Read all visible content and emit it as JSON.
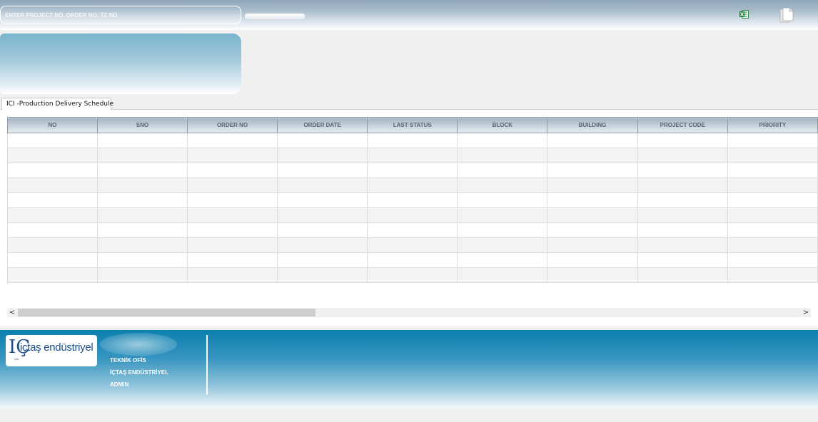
{
  "topbar": {
    "search_placeholder": "ENTER PROJECT NO, ORDER NO, TZ NO",
    "excel_icon": "excel-export-icon",
    "doc_icon": "document-icon"
  },
  "tabs": [
    {
      "label": "ICI -Production Delivery Schedule"
    }
  ],
  "grid": {
    "columns": [
      "NO",
      "SNO",
      "ORDER NO",
      "ORDER DATE",
      "LAST STATUS",
      "BLOCK",
      "BUILDING",
      "PROJECT CODE",
      "PRIORITY"
    ],
    "row_count": 10
  },
  "scrollbar": {
    "left_arrow": "<",
    "right_arrow": ">"
  },
  "footer": {
    "logo_text": "içtaş endüstriyel",
    "logo_mark": "IÇ",
    "logo_sub": "Ünl",
    "department": "TEKNİK OFİS",
    "company": "İÇTAŞ ENDÜSTRİYEL",
    "user": "ADMIN"
  },
  "colors": {
    "footer_blue": "#0d80b0",
    "banner_blue": "#7ab4cd",
    "header_gray": "#a5b3c1"
  }
}
